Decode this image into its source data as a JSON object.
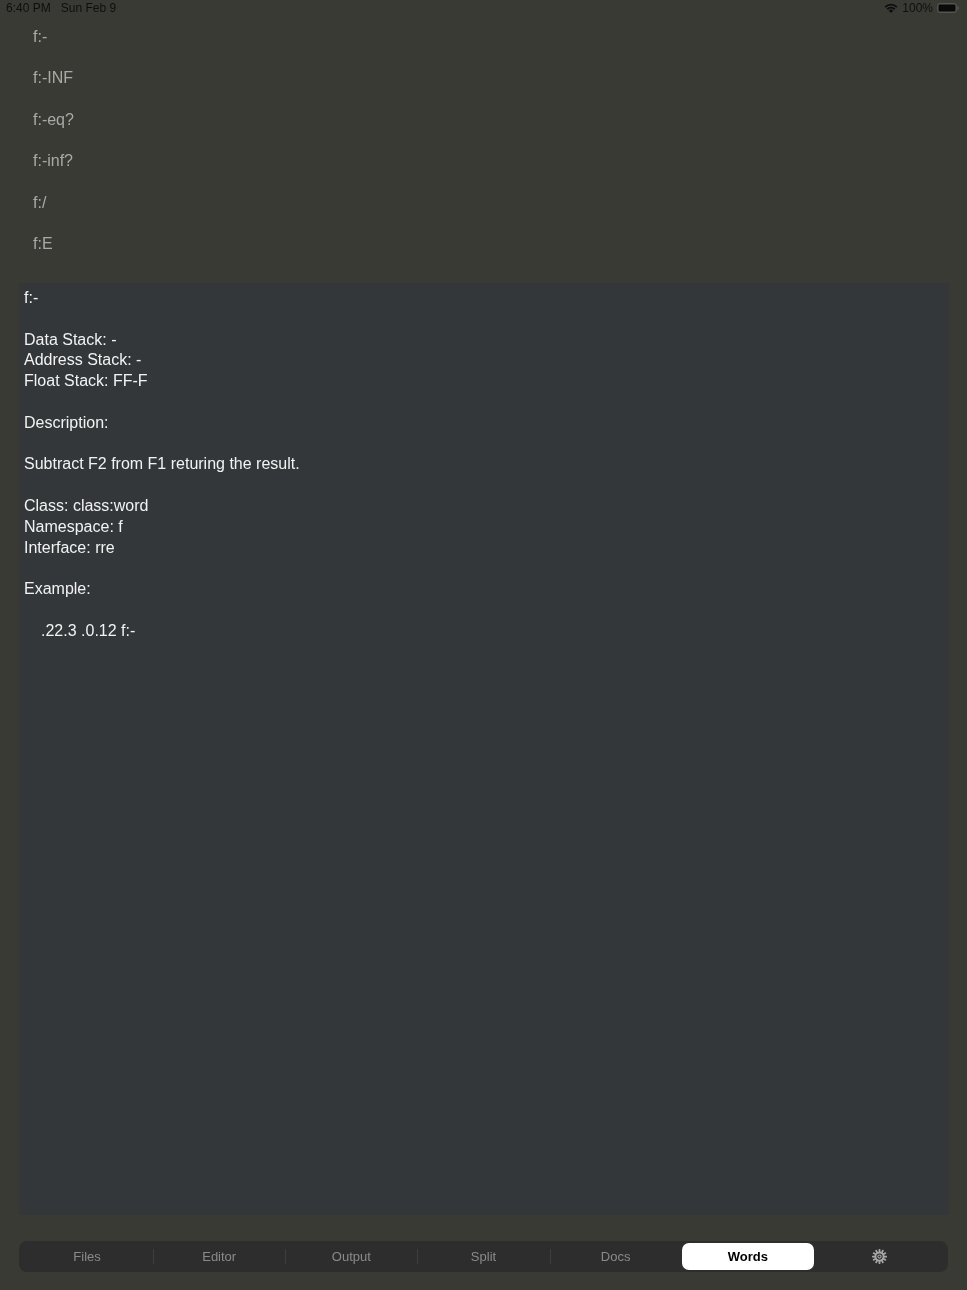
{
  "status_bar": {
    "time": "6:40 PM",
    "date": "Sun Feb 9",
    "battery": "100%"
  },
  "word_list": {
    "items": [
      "f:-",
      "f:-INF",
      "f:-eq?",
      "f:-inf?",
      "f:/",
      "f:E"
    ]
  },
  "detail": {
    "blocks": [
      {
        "kind": "text",
        "lines": [
          "f:-"
        ]
      },
      {
        "kind": "text",
        "lines": [
          "Data Stack: -",
          "Address Stack: -",
          "Float Stack: FF-F"
        ]
      },
      {
        "kind": "text",
        "lines": [
          "Description:"
        ]
      },
      {
        "kind": "text",
        "lines": [
          "Subtract F2 from F1 returing the result."
        ]
      },
      {
        "kind": "text",
        "lines": [
          "Class: class:word",
          "Namespace: f",
          "Interface: rre"
        ]
      },
      {
        "kind": "text",
        "lines": [
          "Example:"
        ]
      },
      {
        "kind": "code",
        "lines": [
          ".22.3 .0.12 f:-"
        ]
      }
    ]
  },
  "tabs": [
    {
      "kind": "text",
      "label": "Files",
      "selected": false
    },
    {
      "kind": "text",
      "label": "Editor",
      "selected": false
    },
    {
      "kind": "text",
      "label": "Output",
      "selected": false
    },
    {
      "kind": "text",
      "label": "Split",
      "selected": false
    },
    {
      "kind": "text",
      "label": "Docs",
      "selected": false
    },
    {
      "kind": "text",
      "label": "Words",
      "selected": true
    },
    {
      "kind": "settings",
      "selected": false
    }
  ]
}
